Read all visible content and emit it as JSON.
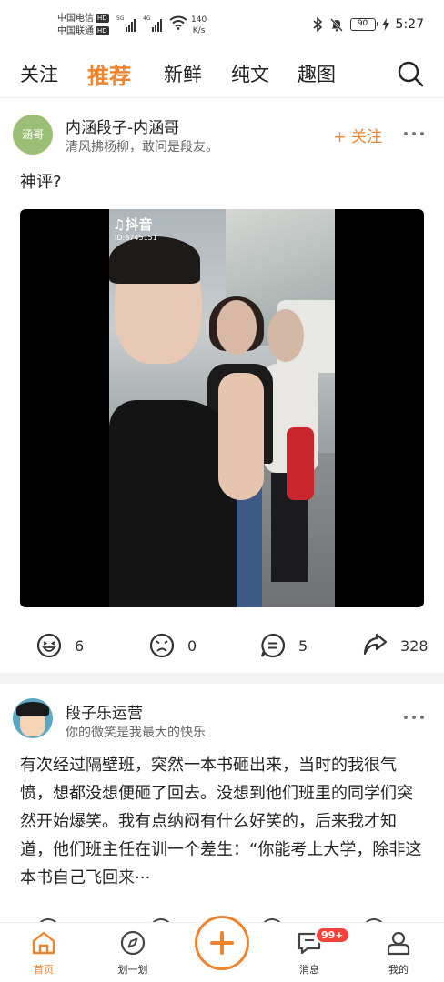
{
  "status_bar": {
    "carrier_1": "中国电信",
    "carrier_2": "中国联通",
    "hd": "HD",
    "net_1": "5G",
    "net_2": "4G",
    "speed_value": "140",
    "speed_unit": "K/s",
    "battery": "90",
    "time": "5:27"
  },
  "top_nav": {
    "tabs": [
      "关注",
      "推荐",
      "新鲜",
      "纯文",
      "趣图"
    ],
    "active_tab": "推荐"
  },
  "post_1": {
    "avatar_text": "涵哥",
    "author": "内涵段子-内涵哥",
    "signature": "清风拂杨柳，敢问是段友。",
    "follow_label": "+ 关注",
    "text": "神评?",
    "video_watermark": "抖音",
    "video_id": "ID:8745151",
    "actions": {
      "like": "6",
      "dislike": "0",
      "comments": "5",
      "shares": "328"
    }
  },
  "post_2": {
    "author": "段子乐运营",
    "signature": "你的微笑是我最大的快乐",
    "text": "有次经过隔壁班，突然一本书砸出来，当时的我很气愤，想都没想便砸了回去。没想到他们班里的同学们突然开始爆笑。我有点纳闷有什么好笑的，后来我才知道，他们班主任在训一个差生：“你能考上大学，除非这本书自己飞回来···"
  },
  "bottom_nav": {
    "home": "首页",
    "swipe": "划一划",
    "messages": "消息",
    "messages_badge": "99+",
    "me": "我的"
  },
  "colors": {
    "accent": "#f0842e",
    "badge": "#f0413b"
  }
}
